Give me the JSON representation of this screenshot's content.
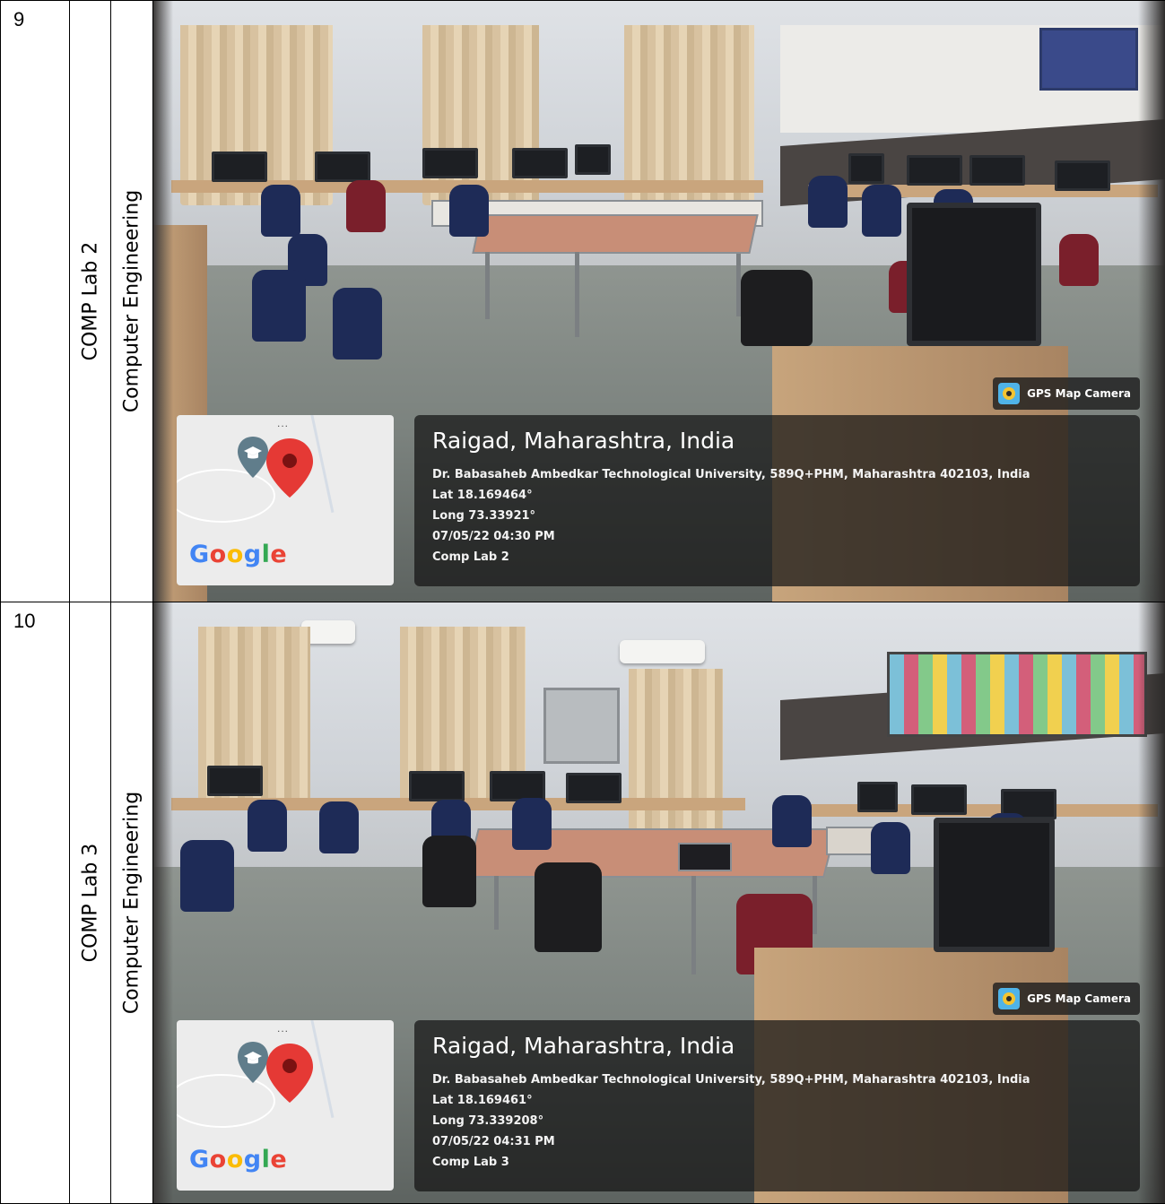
{
  "rows": [
    {
      "number": "9",
      "department": "Computer Engineering",
      "lab": "COMP Lab 2",
      "photo": {
        "badge": "GPS Map Camera",
        "location": "Raigad, Maharashtra, India",
        "address": "Dr. Babasaheb Ambedkar Technological University, 589Q+PHM, Maharashtra 402103, India",
        "lat": "Lat 18.169464°",
        "long": "Long 73.33921°",
        "datetime": "07/05/22 04:30 PM",
        "note": "Comp Lab 2",
        "map_logo": "Google",
        "map_dots": "...",
        "pin_icon": "map-pin-icon"
      }
    },
    {
      "number": "10",
      "department": "Computer Engineering",
      "lab": "COMP Lab 3",
      "photo": {
        "badge": "GPS Map Camera",
        "location": "Raigad, Maharashtra, India",
        "address": "Dr. Babasaheb Ambedkar Technological University, 589Q+PHM, Maharashtra 402103, India",
        "lat": "Lat 18.169461°",
        "long": "Long 73.339208°",
        "datetime": "07/05/22 04:31 PM",
        "note": "Comp Lab 3",
        "map_logo": "Google",
        "map_dots": "...",
        "pin_icon": "map-pin-icon"
      }
    }
  ],
  "colors": {
    "map_pin_red": "#e53935",
    "map_pin_grey": "#607d8b",
    "overlay_bg": "#141414"
  }
}
